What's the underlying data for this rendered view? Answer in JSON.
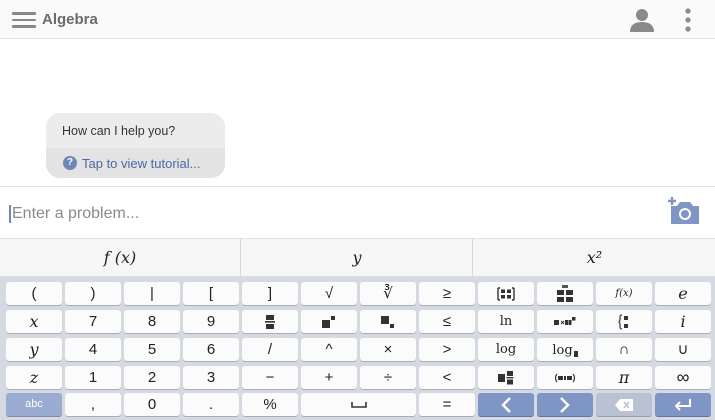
{
  "header": {
    "title": "Algebra",
    "menu_icon": "hamburger-menu-icon",
    "account_icon": "account-icon",
    "more_icon": "more-vertical-icon"
  },
  "chat": {
    "message": "How can I help you?",
    "tutorial_link": "Tap to view tutorial...",
    "help_icon_glyph": "?"
  },
  "input": {
    "placeholder": "Enter a problem...",
    "camera_icon": "camera-icon"
  },
  "keyboard": {
    "tabs": [
      "f (x)",
      "y",
      "x²"
    ],
    "rows": [
      [
        "(",
        ")",
        "|",
        "[",
        "]",
        "√",
        "∛",
        "≥",
        "matrix",
        "matrix-2",
        "f(x)",
        "e"
      ],
      [
        "x",
        "7",
        "8",
        "9",
        "fraction",
        "exponent",
        "subscript",
        "≤",
        "ln",
        "scientific",
        "piecewise",
        "i"
      ],
      [
        "y",
        "4",
        "5",
        "6",
        "/",
        "^",
        "×",
        ">",
        "log",
        "log-base",
        "∩",
        "∪"
      ],
      [
        "z",
        "1",
        "2",
        "3",
        "−",
        "+",
        "÷",
        "<",
        "mixed",
        "interval",
        "π",
        "∞"
      ],
      [
        "abc",
        ",",
        "0",
        ".",
        "%",
        "space",
        "=",
        "left",
        "right",
        "backspace",
        "enter"
      ]
    ],
    "labels": {
      "log_base": "log",
      "ln": "ln",
      "log": "log",
      "fx": "f(x)"
    },
    "colors": {
      "keypad_bg": "#d4d9e2",
      "key_bg": "#fbfbfb",
      "nav_key": "#7f95c5",
      "abc_key": "#9aaccf",
      "accent": "#4c68a7"
    }
  }
}
